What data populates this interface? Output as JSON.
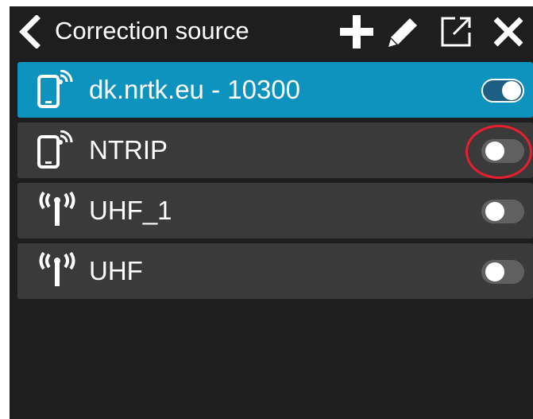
{
  "header": {
    "title": "Correction source",
    "back_icon": "chevron-left-icon",
    "actions": [
      "plus-icon",
      "pencil-icon",
      "external-link-icon",
      "close-icon"
    ]
  },
  "sources": [
    {
      "label": "dk.nrtk.eu - 10300",
      "icon": "phone-signal-icon",
      "enabled": true,
      "selected": true
    },
    {
      "label": "NTRIP",
      "icon": "phone-signal-icon",
      "enabled": false,
      "selected": false
    },
    {
      "label": "UHF_1",
      "icon": "radio-antenna-icon",
      "enabled": false,
      "selected": false
    },
    {
      "label": "UHF",
      "icon": "radio-antenna-icon",
      "enabled": false,
      "selected": false
    }
  ],
  "colors": {
    "background": "#1e1e1e",
    "row": "#3a3a3a",
    "selected_row": "#0d93bd",
    "highlight": "#e81f2e"
  }
}
